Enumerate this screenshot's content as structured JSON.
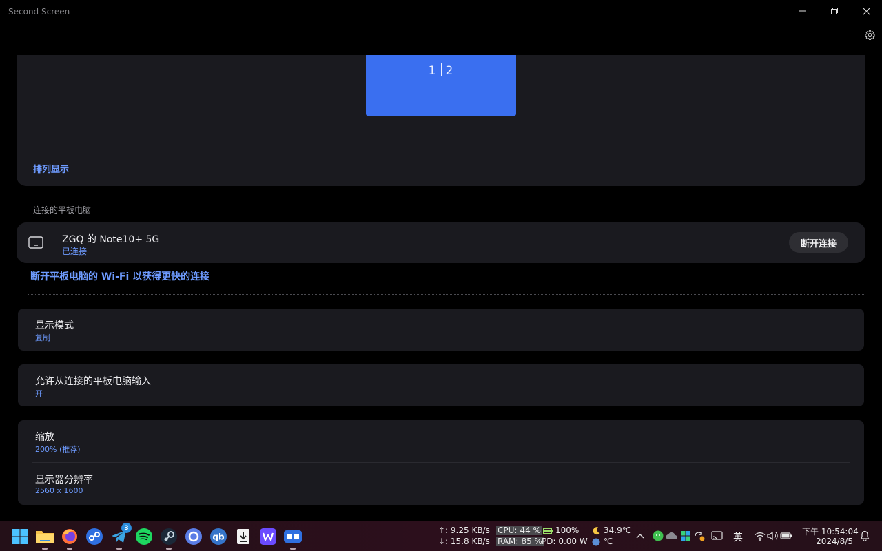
{
  "window": {
    "title": "Second Screen"
  },
  "arrange": {
    "monitor_label_left": "1",
    "monitor_label_right": "2",
    "link_label": "排列显示"
  },
  "connected": {
    "section_label": "连接的平板电脑",
    "device_name": "ZGQ 的 Note10+ 5G",
    "device_status": "已连接",
    "disconnect_label": "断开连接",
    "wifi_tip": "断开平板电脑的 Wi-Fi 以获得更快的连接"
  },
  "settings": {
    "display_mode": {
      "title": "显示模式",
      "value": "复制"
    },
    "allow_input": {
      "title": "允许从连接的平板电脑输入",
      "value": "开"
    },
    "scale": {
      "title": "缩放",
      "value": "200% (推荐)"
    },
    "resolution": {
      "title": "显示器分辨率",
      "value": "2560 x 1600"
    }
  },
  "taskbar": {
    "apps": [
      "start-icon",
      "file-explorer-icon",
      "firefox-icon",
      "share-app-icon",
      "telegram-icon",
      "spotify-icon",
      "steam-icon",
      "browser-app-icon",
      "qbittorrent-icon",
      "downloader-icon",
      "wps-icon",
      "second-screen-icon"
    ],
    "telegram_badge": "3",
    "net_up": "↑: 9.25 KB/s",
    "net_down": "↓: 15.8 KB/s",
    "cpu_label": "CPU:",
    "cpu_value": "44 %",
    "battery_label": "100%",
    "ram_label": "RAM:",
    "ram_value": "85 %",
    "power_label": "PD: 0.00 W",
    "temp_top": "34.9℃",
    "temp_bottom": "℃",
    "ime": "英",
    "clock_time": "下午 10:54:04",
    "clock_date": "2024/8/5"
  },
  "colors": {
    "accent": "#6e9bff",
    "monitor": "#3a6ff0",
    "card": "#1a1a1f",
    "background": "#000000"
  }
}
